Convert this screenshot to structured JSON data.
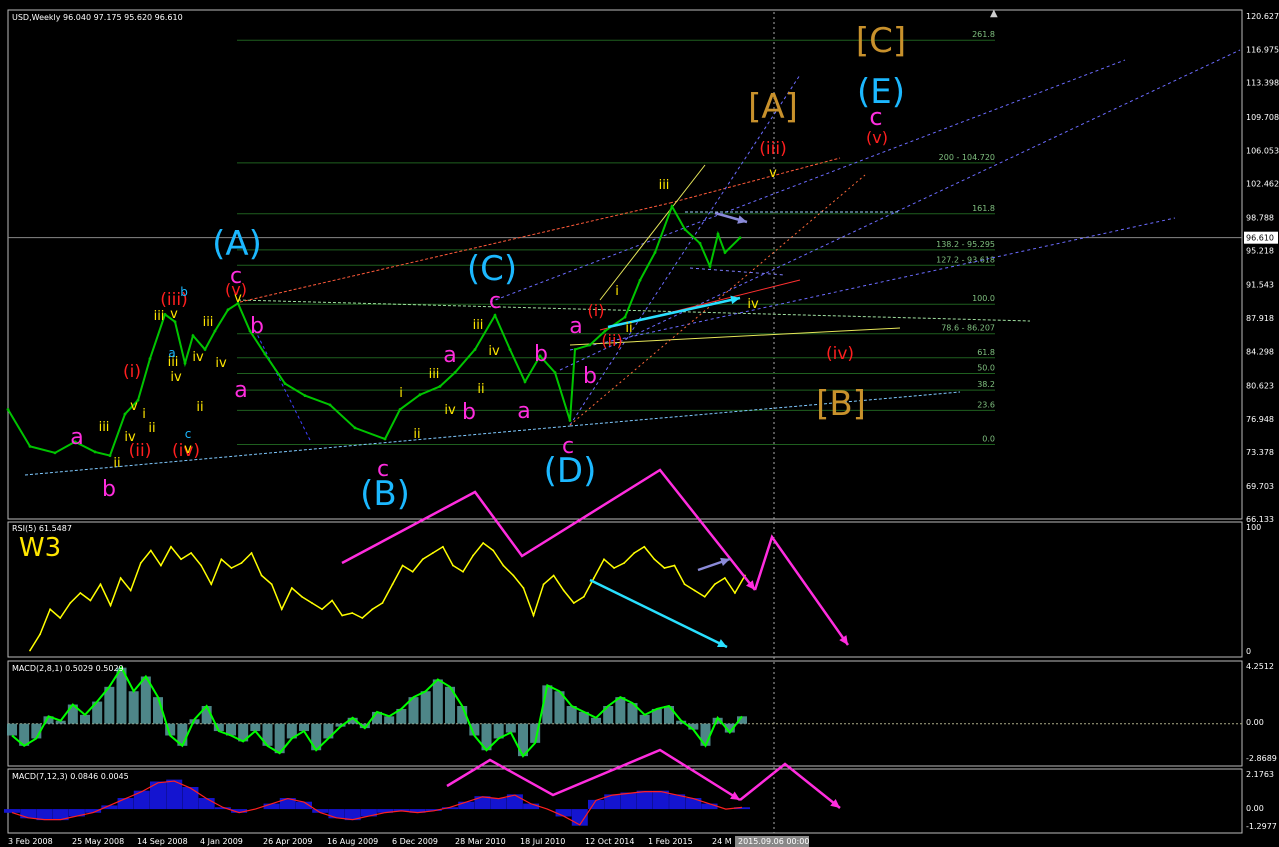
{
  "info": {
    "main": "USD,Weekly  96.040 97.175 95.620 96.610",
    "rsi": "RSI(5) 61.5487",
    "macd1": "MACD(2,8,1) 0.5029 0.5029",
    "macd2": "MACD(7,12,3) 0.0846 0.0045"
  },
  "colors": {
    "price": "#00c400",
    "grid": "#1f5f1f",
    "rsi_line": "#ffff00",
    "macd_fill": "#5c9ea0",
    "macd_line": "#00ff00",
    "macd2_fill": "#1414d0",
    "macd2_signal": "#ff2020",
    "magenta": "#ff2dde",
    "cyan": "#1cb8ff",
    "red": "#ff1f1f",
    "yellow": "#ffe600",
    "orange": "#c8912c"
  },
  "chart_data": {
    "type": "line",
    "symbol": "USD",
    "timeframe": "Weekly",
    "ohlc_last": {
      "open": 96.04,
      "high": 97.175,
      "low": 95.62,
      "close": 96.61
    },
    "price_ylim": [
      66.133,
      120.627
    ],
    "y_ticks": [
      "120.627",
      "116.975",
      "113.398",
      "109.708",
      "106.053",
      "102.462",
      "98.788",
      "95.218",
      "91.543",
      "87.918",
      "84.298",
      "80.623",
      "76.948",
      "73.378",
      "69.703",
      "66.133"
    ],
    "current_price": "96.610",
    "x_ticks": [
      "3 Feb 2008",
      "25 May 2008",
      "14 Sep 2008",
      "4 Jan 2009",
      "26 Apr 2009",
      "16 Aug 2009",
      "6 Dec 2009",
      "28 Mar 2010",
      "18 Jul 2010",
      "12 Oct 2014",
      "1 Feb 2015",
      "24 M"
    ],
    "cursor_time": "2015.09.06 00:00",
    "price_series": [
      {
        "x": 8,
        "y": 78.0
      },
      {
        "x": 30,
        "y": 74.0
      },
      {
        "x": 55,
        "y": 73.3
      },
      {
        "x": 75,
        "y": 74.5
      },
      {
        "x": 95,
        "y": 73.4
      },
      {
        "x": 110,
        "y": 73.0
      },
      {
        "x": 125,
        "y": 77.5
      },
      {
        "x": 138,
        "y": 79.0
      },
      {
        "x": 150,
        "y": 83.5
      },
      {
        "x": 165,
        "y": 88.3
      },
      {
        "x": 175,
        "y": 87.5
      },
      {
        "x": 185,
        "y": 83.0
      },
      {
        "x": 193,
        "y": 86.0
      },
      {
        "x": 205,
        "y": 84.5
      },
      {
        "x": 215,
        "y": 86.5
      },
      {
        "x": 228,
        "y": 88.8
      },
      {
        "x": 238,
        "y": 89.5
      },
      {
        "x": 250,
        "y": 86.5
      },
      {
        "x": 265,
        "y": 84.0
      },
      {
        "x": 285,
        "y": 80.8
      },
      {
        "x": 305,
        "y": 79.5
      },
      {
        "x": 330,
        "y": 78.5
      },
      {
        "x": 355,
        "y": 76.0
      },
      {
        "x": 385,
        "y": 74.8
      },
      {
        "x": 400,
        "y": 78.0
      },
      {
        "x": 420,
        "y": 79.6
      },
      {
        "x": 440,
        "y": 80.5
      },
      {
        "x": 455,
        "y": 82.0
      },
      {
        "x": 475,
        "y": 84.5
      },
      {
        "x": 495,
        "y": 88.2
      },
      {
        "x": 510,
        "y": 84.5
      },
      {
        "x": 525,
        "y": 81.0
      },
      {
        "x": 540,
        "y": 83.8
      },
      {
        "x": 555,
        "y": 82.0
      },
      {
        "x": 570,
        "y": 76.8
      },
      {
        "x": 575,
        "y": 84.5
      },
      {
        "x": 590,
        "y": 85.0
      },
      {
        "x": 605,
        "y": 86.5
      },
      {
        "x": 625,
        "y": 88.0
      },
      {
        "x": 640,
        "y": 92.0
      },
      {
        "x": 655,
        "y": 95.0
      },
      {
        "x": 672,
        "y": 100.0
      },
      {
        "x": 685,
        "y": 97.5
      },
      {
        "x": 700,
        "y": 96.0
      },
      {
        "x": 710,
        "y": 93.5
      },
      {
        "x": 718,
        "y": 97.0
      },
      {
        "x": 725,
        "y": 95.0
      },
      {
        "x": 740,
        "y": 96.6
      }
    ],
    "fib_levels": [
      {
        "label": "261.8",
        "y": 118.0
      },
      {
        "label": "200 - 104.720",
        "y": 104.72
      },
      {
        "label": "161.8",
        "y": 99.2
      },
      {
        "label": "138.2 - 95.295",
        "y": 95.295
      },
      {
        "label": "127.2 - 93.618",
        "y": 93.618
      },
      {
        "label": "100.0",
        "y": 89.4
      },
      {
        "label": "78.6 - 86.207",
        "y": 86.207
      },
      {
        "label": "61.8",
        "y": 83.6
      },
      {
        "label": "50.0",
        "y": 81.9
      },
      {
        "label": "38.2",
        "y": 80.1
      },
      {
        "label": "23.6",
        "y": 77.9
      },
      {
        "label": "0.0",
        "y": 74.2
      }
    ],
    "rsi": {
      "ylim": [
        0,
        100
      ],
      "ticks": [
        "100",
        "0"
      ],
      "values": [
        2,
        15,
        35,
        28,
        40,
        48,
        42,
        55,
        38,
        60,
        50,
        72,
        82,
        70,
        85,
        75,
        80,
        70,
        55,
        75,
        68,
        72,
        80,
        62,
        55,
        35,
        52,
        45,
        40,
        35,
        42,
        30,
        32,
        28,
        35,
        40,
        55,
        70,
        65,
        75,
        80,
        85,
        70,
        65,
        78,
        88,
        82,
        70,
        62,
        52,
        30,
        55,
        62,
        50,
        40,
        45,
        60,
        75,
        68,
        72,
        80,
        85,
        75,
        68,
        70,
        55,
        50,
        45,
        55,
        60,
        48,
        62
      ]
    },
    "macd1": {
      "ylim": [
        -2.8689,
        4.2512
      ],
      "ticks": [
        "4.2512",
        "0.00",
        "-2.8689"
      ],
      "values": [
        -0.8,
        -1.5,
        -1.0,
        0.5,
        0.2,
        1.3,
        0.6,
        1.5,
        2.5,
        3.8,
        2.2,
        3.2,
        1.8,
        -0.8,
        -1.5,
        0.3,
        1.2,
        -0.5,
        -0.8,
        -1.2,
        -0.5,
        -1.5,
        -2.0,
        -1.0,
        -0.5,
        -1.8,
        -1.0,
        -0.2,
        0.4,
        -0.3,
        0.8,
        0.5,
        1.0,
        1.8,
        2.2,
        3.0,
        2.5,
        1.2,
        -0.8,
        -1.8,
        -1.0,
        -0.6,
        -2.2,
        -1.3,
        2.6,
        2.2,
        1.2,
        0.8,
        0.4,
        1.2,
        1.8,
        1.4,
        0.6,
        1.0,
        1.2,
        0.2,
        -0.4,
        -1.5,
        0.4,
        -0.6,
        0.5
      ]
    },
    "macd2": {
      "ylim": [
        -1.2977,
        2.1763
      ],
      "ticks": [
        "2.1763",
        "0.00",
        "-1.2977"
      ],
      "values": [
        -0.2,
        -0.5,
        -0.6,
        -0.6,
        -0.4,
        -0.2,
        0.2,
        0.6,
        1.0,
        1.5,
        1.6,
        1.2,
        0.6,
        0.1,
        -0.2,
        0.0,
        0.3,
        0.6,
        0.4,
        -0.2,
        -0.5,
        -0.6,
        -0.4,
        -0.2,
        -0.1,
        -0.2,
        -0.1,
        0.1,
        0.4,
        0.7,
        0.6,
        0.8,
        0.3,
        0.0,
        -0.4,
        -0.9,
        0.5,
        0.8,
        0.9,
        1.0,
        1.0,
        0.8,
        0.6,
        0.3,
        0.0,
        0.1
      ]
    }
  },
  "annotations": {
    "A_big": "(A)",
    "B_big": "(B)",
    "C_big": "(C)",
    "D_big": "(D)",
    "E_big": "(E)",
    "A_box": "[A]",
    "B_box": "[B]",
    "C_box": "[C]",
    "c": "c",
    "a": "a",
    "b": "b",
    "i": "i",
    "ii": "ii",
    "iii": "iii",
    "iv": "iv",
    "v": "v",
    "ri": "(i)",
    "rii": "(ii)",
    "riii": "(iii)",
    "riv": "(iv)",
    "rv": "(v)",
    "w3": "W3"
  }
}
